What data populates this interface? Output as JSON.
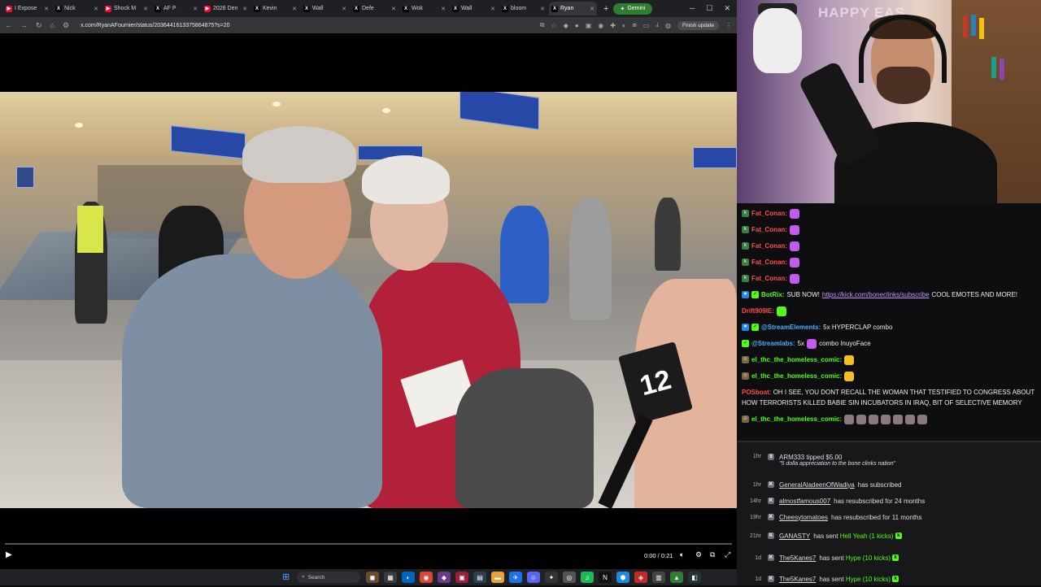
{
  "browser": {
    "tabs": [
      {
        "label": "I Expose",
        "color": "#ff0033"
      },
      {
        "label": "Nick",
        "color": "#000000"
      },
      {
        "label": "Shock M",
        "color": "#ff0033"
      },
      {
        "label": "AF P",
        "color": "#000000"
      },
      {
        "label": "2028 Den",
        "color": "#ff0033"
      },
      {
        "label": "Kevin",
        "color": "#000000"
      },
      {
        "label": "Wall",
        "color": "#000000"
      },
      {
        "label": "Defe",
        "color": "#000000"
      },
      {
        "label": "Wok",
        "color": "#000000"
      },
      {
        "label": "Wall",
        "color": "#000000"
      },
      {
        "label": "bloom",
        "color": "#000000"
      },
      {
        "label": "Ryan",
        "color": "#000000"
      }
    ],
    "active_tab_index": 11,
    "new_tab_label": "+",
    "gemini_label": "Gemini",
    "url": "x.com/RyanAFournier/status/2036441613375864875?s=20",
    "finish_update_label": "Finish update"
  },
  "video": {
    "time": "0:00 / 0:21",
    "progress": 0.0,
    "station_badge": "12",
    "icons": [
      "play-icon",
      "volume-icon",
      "settings-icon",
      "pip-icon",
      "fullscreen-icon"
    ]
  },
  "taskbar": {
    "search_placeholder": "Search"
  },
  "webcam": {
    "sign_text": "HAPPY EAS"
  },
  "chat": {
    "messages": [
      {
        "user": "Fat_Conan:",
        "user_color": "#ff4d4d",
        "text": "",
        "emote": "#c45bf0"
      },
      {
        "user": "Fat_Conan:",
        "user_color": "#ff4d4d",
        "text": "",
        "emote": "#c45bf0"
      },
      {
        "user": "Fat_Conan:",
        "user_color": "#ff4d4d",
        "text": "",
        "emote": "#c45bf0"
      },
      {
        "user": "Fat_Conan:",
        "user_color": "#ff4d4d",
        "text": "",
        "emote": "#c45bf0"
      },
      {
        "user": "Fat_Conan:",
        "user_color": "#ff4d4d",
        "text": "",
        "emote": "#c45bf0"
      }
    ],
    "botrix": {
      "user": "BotRix:",
      "text_before": "SUB NOW!",
      "link": "https://kick.com/boneclinks/subscribe",
      "text_after": "COOL EMOTES AND MORE!"
    },
    "drift": {
      "user": "Drift909IE:",
      "user_color": "#ff4d4d"
    },
    "se_message": {
      "user": "@StreamElements:",
      "text": "5x HYPERCLAP combo"
    },
    "sl_message": {
      "user": "@Streamlabs:",
      "text": "5x",
      "text_after": "combo InuyoFace"
    },
    "elthc1": {
      "user": "el_thc_the_homeless_comic:",
      "user_color": "#53fc18"
    },
    "elthc2": {
      "user": "el_thc_the_homeless_comic:",
      "user_color": "#53fc18"
    },
    "posboat": {
      "user": "POSboat:",
      "text": "OH I SEE, YOU DONT RECALL THE WOMAN THAT TESTIFIED TO CONGRESS ABOUT HOW TERRORISTS KILLED BABIE SIN INCUBATORS IN IRAQ, BIT OF SELECTIVE MEMORY"
    },
    "elthc3": {
      "user": "el_thc_the_homeless_comic:",
      "user_color": "#53fc18"
    }
  },
  "feed": {
    "tip": {
      "ago": "1hr",
      "name": "ARM333",
      "text": "tipped $5.00",
      "sub": "\"5 dolla appreciation to the bone clinks nation\""
    },
    "rows": [
      {
        "ago": "1hr",
        "name": "GeneralAladeenOfWadiya",
        "text": "has subscribed",
        "green": ""
      },
      {
        "ago": "14hr",
        "name": "almostfamous007",
        "text": "has resubscribed for 24 months",
        "green": ""
      },
      {
        "ago": "19hr",
        "name": "Cheesytomatoes",
        "text": "has resubscribed for 11 months",
        "green": ""
      },
      {
        "ago": "21hr",
        "name": "GANASTY",
        "text": "has sent",
        "green": "Hell Yeah (1 kicks)"
      },
      {
        "ago": "1d",
        "name": "The5Kanes7",
        "text": "has sent",
        "green": "Hype (10 kicks)"
      },
      {
        "ago": "1d",
        "name": "The5Kanes7",
        "text": "has sent",
        "green": "Hype (10 kicks)"
      }
    ]
  }
}
